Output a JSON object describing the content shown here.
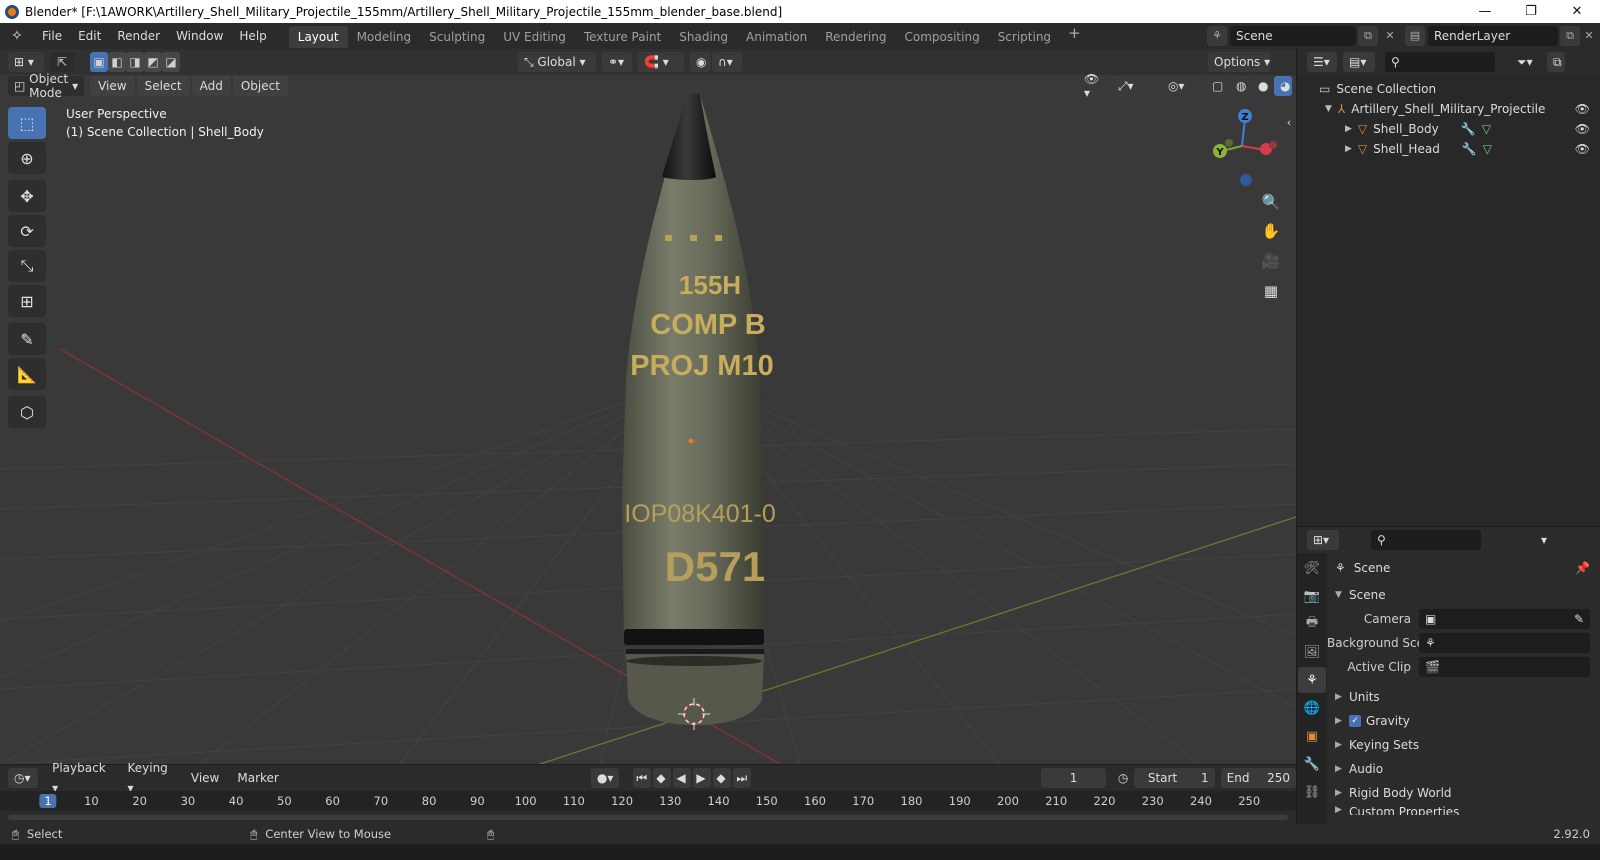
{
  "window": {
    "title": "Blender* [F:\\1AWORK\\Artillery_Shell_Military_Projectile_155mm/Artillery_Shell_Military_Projectile_155mm_blender_base.blend]",
    "minimize": "—",
    "restore": "❐",
    "close": "✕"
  },
  "menu": [
    "File",
    "Edit",
    "Render",
    "Window",
    "Help"
  ],
  "workspaces": [
    "Layout",
    "Modeling",
    "Sculpting",
    "UV Editing",
    "Texture Paint",
    "Shading",
    "Animation",
    "Rendering",
    "Compositing",
    "Scripting"
  ],
  "active_workspace": "Layout",
  "scene_name": "Scene",
  "render_layer": "RenderLayer",
  "viewport": {
    "mode": "Object Mode",
    "menus": [
      "View",
      "Select",
      "Add",
      "Object"
    ],
    "orientation": "Global",
    "options": "Options",
    "perspective_label": "User Perspective",
    "collection_label": "(1) Scene Collection | Shell_Body",
    "gizmo": {
      "x": "X",
      "y": "Y",
      "z": "Z"
    },
    "model_text": [
      "155H",
      "COMP B",
      "PROJ M10",
      "IOP08K401-0",
      "D571"
    ],
    "tools": [
      "select-box",
      "cursor",
      "move",
      "rotate",
      "scale",
      "transform",
      "annotate",
      "measure",
      "add-cube"
    ]
  },
  "outliner": {
    "root": "Scene Collection",
    "collection": "Artillery_Shell_Military_Projectile",
    "objects": [
      "Shell_Body",
      "Shell_Head"
    ]
  },
  "properties": {
    "header": "Scene",
    "section": "Scene",
    "fields": [
      {
        "label": "Camera",
        "value": ""
      },
      {
        "label": "Background Sce...",
        "value": ""
      },
      {
        "label": "Active Clip",
        "value": ""
      }
    ],
    "panels": [
      "Units",
      "Gravity",
      "Keying Sets",
      "Audio",
      "Rigid Body World",
      "Custom Properties"
    ],
    "gravity_checked": true
  },
  "timeline": {
    "menus": [
      "Playback",
      "Keying",
      "View",
      "Marker"
    ],
    "current_frame": "1",
    "start_label": "Start",
    "start": "1",
    "end_label": "End",
    "end": "250",
    "ticks": [
      "1",
      "10",
      "20",
      "30",
      "40",
      "50",
      "60",
      "70",
      "80",
      "90",
      "100",
      "110",
      "120",
      "130",
      "140",
      "150",
      "160",
      "170",
      "180",
      "190",
      "200",
      "210",
      "220",
      "230",
      "240",
      "250"
    ]
  },
  "status": {
    "left": "Select",
    "middle": "Center View to Mouse",
    "version": "2.92.0"
  }
}
